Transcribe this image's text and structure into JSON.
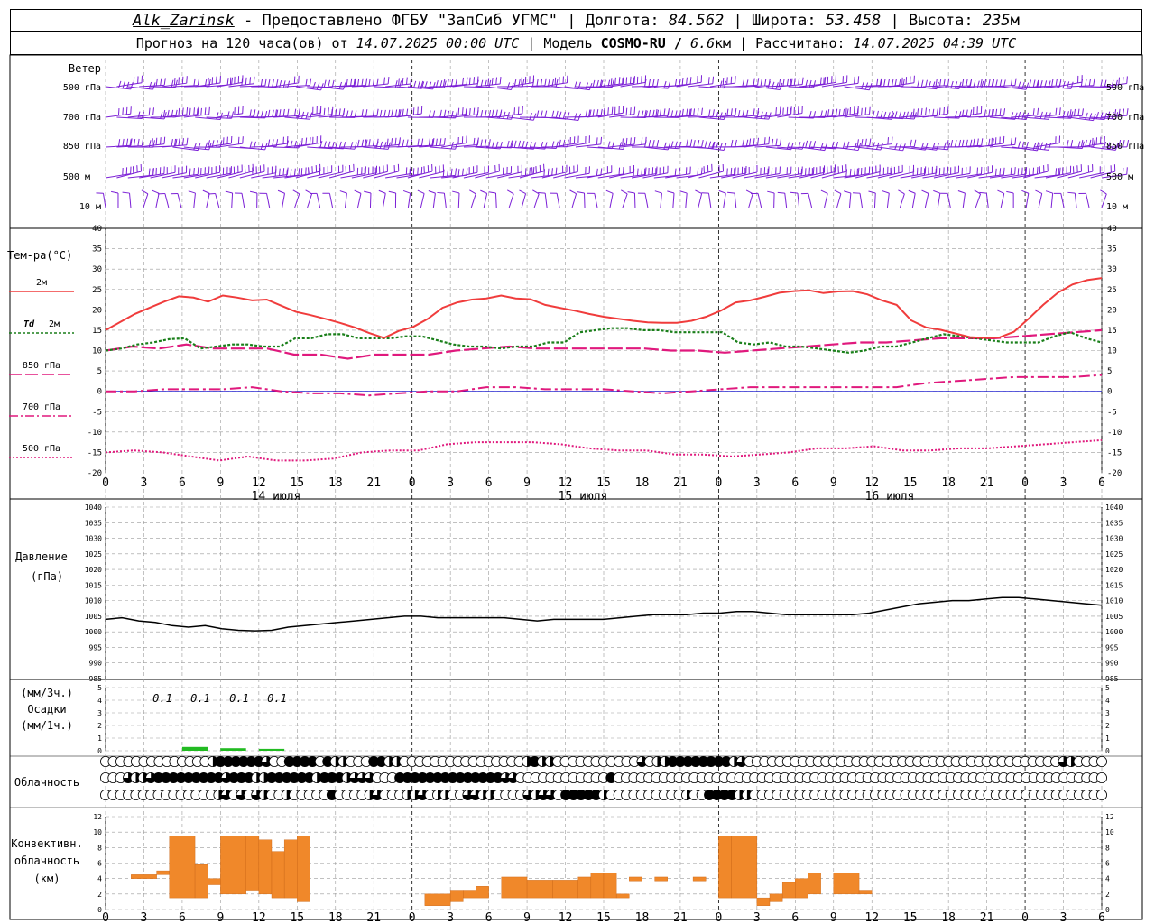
{
  "header": {
    "station": "Alk_Zarinsk",
    "provider": " - Предоставлено ФГБУ \"ЗапСиб УГМС\" | Долгота: ",
    "lon": "84.562",
    "lat_label": " | Широта: ",
    "lat": "53.458",
    "alt_label": " | Высота: ",
    "alt": "235",
    "alt_unit": "м",
    "fc_prefix": "Прогноз на 120 часа(ов) от ",
    "fc_start": "14.07.2025 00:00 UTC",
    "model_label": "  | Модель ",
    "model": "COSMO-RU / ",
    "resolution": "6.6",
    "res_unit": "км",
    "calc_label": " | Рассчитано: ",
    "calc_time": "14.07.2025 04:39 UTC"
  },
  "labels": {
    "wind": "Ветер",
    "wind_levels": [
      "500 гПа",
      "700 гПа",
      "850 гПа",
      "500 м",
      "10 м"
    ],
    "temp": "Тем-ра(°С)",
    "t2m": "2м",
    "td_a": "Td",
    "td_b": "2м",
    "t850": "850 гПа",
    "t700": "700 гПа",
    "t500": "500 гПа",
    "pressure": "Давление",
    "pressure_unit": "(гПа)",
    "precip_a": "(мм/3ч.)",
    "precip_b": "Осадки",
    "precip_c": "(мм/1ч.)",
    "cloud": "Облачность",
    "conv_a": "Конвективн.",
    "conv_b": "облачность",
    "conv_c": "(км)",
    "dates": [
      "14 июля",
      "15 июля",
      "16 июля"
    ]
  },
  "colors": {
    "wind": "#7b1fd6",
    "t2m": "#f03c3c",
    "td": "#1a7f1a",
    "t850": "#e0197d",
    "t700": "#e0197d",
    "t500": "#e0197d",
    "pressure": "#000000",
    "precip": "#22bb22",
    "conv": "#f0882a",
    "grid": "#9a9a9a"
  },
  "chart_data": [
    {
      "type": "line",
      "name": "temperature",
      "x_hours": [
        0,
        3,
        6,
        9,
        12,
        15,
        18,
        21,
        24,
        27,
        30,
        33,
        36,
        39,
        42,
        45,
        48,
        51,
        54,
        57,
        60,
        63,
        66,
        69,
        72,
        75,
        78,
        81,
        84,
        87,
        90,
        93,
        96,
        99,
        102,
        105,
        108,
        111,
        114,
        117,
        120,
        123,
        126,
        129,
        132,
        135,
        138,
        141,
        144,
        147,
        150,
        153,
        156,
        159,
        162,
        165,
        168,
        171,
        174,
        177,
        180,
        183,
        186,
        189,
        192,
        195,
        198,
        201,
        204,
        207,
        210,
        213,
        216,
        219,
        222,
        225,
        228,
        231,
        234
      ],
      "x_ticks": [
        "0",
        "3",
        "6",
        "9",
        "12",
        "15",
        "18",
        "21",
        "0",
        "3",
        "6",
        "9",
        "12",
        "15",
        "18",
        "21",
        "0",
        "3",
        "6",
        "9",
        "12",
        "15",
        "18",
        "21",
        "0",
        "3",
        "6"
      ],
      "ylim": [
        -20,
        40
      ],
      "y_ticks": [
        -20,
        -15,
        -10,
        -5,
        0,
        5,
        10,
        15,
        20,
        25,
        30,
        35,
        40
      ],
      "series_2m": [
        15,
        17,
        19,
        20.5,
        22,
        23.3,
        23,
        22,
        23.5,
        23,
        22.3,
        22.5,
        21,
        19.5,
        18.7,
        17.8,
        16.8,
        15.7,
        14.3,
        13.1,
        14.8,
        15.8,
        17.8,
        20.5,
        21.8,
        22.5,
        22.8,
        23.5,
        22.8,
        22.6,
        21.2,
        20.5,
        19.8,
        19,
        18.3,
        17.8,
        17.3,
        16.9,
        16.8,
        16.8,
        17.3,
        18.3,
        19.8,
        21.8,
        22.3,
        23.2,
        24.2,
        24.6,
        24.8,
        24.1,
        24.5,
        24.6,
        23.8,
        22.3,
        21.2,
        17.4,
        15.7,
        15.1,
        14.2,
        13.3,
        13.1,
        13.2,
        14.6,
        17.8,
        21.2,
        24.2,
        26.2,
        27.3,
        27.8
      ],
      "series_td": [
        10,
        10.5,
        11.5,
        12,
        12.8,
        13,
        10.5,
        11,
        11.5,
        11.5,
        11,
        11,
        13,
        13,
        14,
        14,
        13,
        13,
        13,
        13.5,
        13.5,
        12.5,
        11.5,
        11,
        11,
        10.5,
        11,
        11,
        12,
        12,
        14.5,
        15,
        15.5,
        15.5,
        15,
        15,
        14.5,
        14.5,
        14.5,
        14.5,
        12,
        11.5,
        12,
        11,
        11,
        10.5,
        10,
        9.5,
        10,
        11,
        11,
        12,
        13,
        14,
        13.5,
        13,
        12.5,
        12,
        12,
        12,
        13.5,
        14.5,
        13,
        12
      ],
      "series_850": [
        10,
        11,
        10.5,
        11.5,
        10.5,
        10.5,
        10.5,
        9,
        9,
        8,
        9,
        9,
        9,
        10,
        10.5,
        11,
        10.5,
        10.5,
        10.5,
        10.5,
        10.5,
        10,
        10,
        9.5,
        10,
        10.5,
        11,
        11.5,
        12,
        12,
        12.5,
        13,
        13,
        13,
        13.5,
        14,
        14.5,
        15
      ],
      "series_700": [
        0,
        0,
        0.5,
        0.5,
        0.5,
        1,
        0,
        -0.5,
        -0.5,
        -1,
        -0.5,
        0,
        0,
        1,
        1,
        0.5,
        0.5,
        0.5,
        0,
        -0.5,
        0,
        0.5,
        1,
        1,
        1,
        1,
        1,
        1,
        2,
        2.5,
        3,
        3.5,
        3.5,
        3.5,
        4
      ],
      "series_500": [
        -15,
        -14.5,
        -15,
        -16,
        -17,
        -16,
        -17,
        -17,
        -16.5,
        -15,
        -14.5,
        -14.5,
        -13,
        -12.5,
        -12.5,
        -12.5,
        -13,
        -14,
        -14.5,
        -14.5,
        -15.5,
        -15.5,
        -16,
        -15.5,
        -15,
        -14,
        -14,
        -13.5,
        -14.5,
        -14.5,
        -14,
        -14,
        -13.5,
        -13,
        -12.5,
        -12
      ]
    },
    {
      "type": "line",
      "name": "pressure",
      "ylim": [
        985,
        1040
      ],
      "y_ticks": [
        985,
        990,
        995,
        1000,
        1005,
        1010,
        1015,
        1020,
        1025,
        1030,
        1035,
        1040
      ],
      "values": [
        1004,
        1004.5,
        1003.5,
        1003,
        1002,
        1001.5,
        1002,
        1001,
        1000.5,
        1000.3,
        1000.5,
        1001.5,
        1002,
        1002.5,
        1003,
        1003.5,
        1004,
        1004.5,
        1005,
        1005,
        1004.5,
        1004.5,
        1004.5,
        1004.5,
        1004.5,
        1004,
        1003.5,
        1004,
        1004,
        1004,
        1004,
        1004.5,
        1005,
        1005.5,
        1005.5,
        1005.5,
        1006,
        1006,
        1006.5,
        1006.5,
        1006,
        1005.5,
        1005.5,
        1005.5,
        1005.5,
        1005.5,
        1006,
        1007,
        1008,
        1009,
        1009.5,
        1010,
        1010,
        1010.5,
        1011,
        1011,
        1010.5,
        1010,
        1009.5,
        1009,
        1008.5
      ]
    },
    {
      "type": "bar",
      "name": "precipitation",
      "ylim": [
        0,
        5
      ],
      "y_ticks": [
        0,
        1,
        2,
        3,
        4,
        5
      ],
      "precip_labels": [
        "0.1",
        "0.1",
        "0.1",
        "0.1"
      ],
      "bars_mm": [
        [
          6,
          0.3
        ],
        [
          9,
          0.2
        ],
        [
          12,
          0.15
        ]
      ]
    },
    {
      "type": "heatmap",
      "name": "cloud_cover_okta_rows",
      "rows": [
        [
          0,
          0,
          0,
          0,
          0,
          0,
          0,
          0,
          0,
          0,
          0,
          0,
          0,
          0,
          4,
          8,
          8,
          8,
          8,
          8,
          8,
          6,
          0,
          0,
          8,
          8,
          8,
          8,
          0,
          8,
          4,
          4,
          0,
          0,
          0,
          8,
          8,
          4,
          4,
          0,
          0,
          0,
          0,
          0,
          0,
          0,
          0,
          0,
          0,
          0,
          0,
          0,
          0,
          0,
          0,
          4,
          8,
          4,
          4,
          0,
          0,
          0,
          0,
          0,
          0,
          0,
          0,
          0,
          0,
          0,
          6,
          0,
          4,
          4,
          8,
          8,
          8,
          8,
          8,
          8,
          8,
          8,
          4,
          6,
          0,
          0,
          0,
          0,
          0,
          0,
          0,
          0,
          0,
          0,
          0,
          0,
          0,
          0,
          0,
          0,
          0,
          0,
          0,
          0,
          0,
          0,
          0,
          0,
          0,
          0,
          0,
          0,
          0,
          0,
          0,
          0,
          0,
          0,
          0,
          0,
          0,
          0,
          0,
          0,
          0,
          6,
          4,
          0,
          0,
          0,
          0
        ],
        [
          0,
          0,
          0,
          6,
          4,
          4,
          6,
          8,
          8,
          8,
          8,
          8,
          8,
          8,
          8,
          8,
          6,
          8,
          8,
          8,
          4,
          4,
          8,
          8,
          8,
          8,
          8,
          8,
          4,
          8,
          8,
          8,
          4,
          6,
          6,
          6,
          0,
          0,
          0,
          8,
          8,
          8,
          8,
          8,
          8,
          8,
          8,
          8,
          8,
          8,
          8,
          8,
          8,
          6,
          6,
          0,
          0,
          0,
          0,
          0,
          0,
          0,
          0,
          0,
          0,
          0,
          0,
          8,
          0,
          0,
          0,
          0,
          0,
          0,
          0,
          0,
          0,
          0,
          0,
          0,
          0,
          0,
          0,
          0,
          0,
          0,
          0,
          0,
          0,
          0,
          0,
          0,
          0,
          0,
          0,
          0,
          0,
          0,
          0,
          0,
          0,
          0,
          0,
          0,
          0,
          0,
          0,
          0,
          0,
          0,
          0,
          0,
          0,
          0,
          0,
          0,
          0,
          0,
          0,
          0,
          0,
          0,
          0,
          0,
          0,
          0,
          0,
          0,
          0,
          0,
          0,
          0,
          0
        ],
        [
          0,
          0,
          0,
          0,
          0,
          0,
          0,
          0,
          0,
          0,
          0,
          0,
          0,
          0,
          0,
          4,
          6,
          0,
          6,
          0,
          6,
          4,
          0,
          0,
          4,
          0,
          0,
          0,
          0,
          0,
          8,
          0,
          0,
          0,
          0,
          4,
          6,
          0,
          0,
          0,
          4,
          4,
          6,
          0,
          4,
          4,
          0,
          0,
          6,
          6,
          4,
          4,
          0,
          0,
          0,
          0,
          6,
          4,
          6,
          6,
          0,
          8,
          8,
          8,
          8,
          8,
          4,
          0,
          0,
          0,
          0,
          0,
          0,
          0,
          0,
          0,
          0,
          4,
          0,
          0,
          8,
          8,
          8,
          8,
          4,
          4,
          0,
          0,
          0,
          0,
          0,
          0,
          0,
          0,
          0,
          0,
          0,
          0,
          0,
          0,
          0,
          0,
          0,
          0,
          0,
          0,
          0,
          0,
          0,
          0,
          0,
          0,
          0,
          0,
          0,
          0,
          0,
          0,
          0,
          0,
          0,
          0,
          0,
          0,
          0,
          0,
          0,
          0,
          0,
          0,
          0,
          0,
          0
        ]
      ]
    },
    {
      "type": "bar",
      "name": "convective_cloud",
      "ylim": [
        0,
        12
      ],
      "y_ticks": [
        0,
        2,
        4,
        6,
        8,
        10,
        12
      ],
      "segments_hours_km": [
        [
          2,
          4,
          4,
          4.5
        ],
        [
          4,
          5,
          4.5,
          5
        ],
        [
          5,
          7,
          1.5,
          9.5
        ],
        [
          7,
          8,
          1.5,
          5.8
        ],
        [
          8,
          9,
          3.2,
          4
        ],
        [
          9,
          11,
          2,
          9.5
        ],
        [
          11,
          12,
          2.5,
          9.5
        ],
        [
          12,
          13,
          2,
          9
        ],
        [
          13,
          14,
          1.5,
          7.5
        ],
        [
          14,
          15,
          1.5,
          9
        ],
        [
          15,
          16,
          1,
          9.5
        ],
        [
          25,
          27,
          0.5,
          2
        ],
        [
          27,
          28,
          1,
          2.5
        ],
        [
          28,
          29,
          1.5,
          2.5
        ],
        [
          29,
          30,
          1.5,
          3
        ],
        [
          31,
          33,
          1.5,
          4.2
        ],
        [
          33,
          35,
          1.5,
          3.8
        ],
        [
          35,
          37,
          1.5,
          3.8
        ],
        [
          37,
          38,
          1.5,
          4.2
        ],
        [
          38,
          39,
          1.5,
          4.7
        ],
        [
          39,
          40,
          1.5,
          4.7
        ],
        [
          40,
          41,
          1.5,
          2
        ],
        [
          41,
          42,
          3.7,
          4.2
        ],
        [
          43,
          44,
          3.7,
          4.2
        ],
        [
          46,
          47,
          3.7,
          4.2
        ],
        [
          48,
          49,
          1.5,
          9.5
        ],
        [
          49,
          51,
          1.5,
          9.5
        ],
        [
          51,
          52,
          0.5,
          1.5
        ],
        [
          52,
          53,
          1,
          2
        ],
        [
          53,
          54,
          1.5,
          3.5
        ],
        [
          54,
          55,
          1.5,
          4
        ],
        [
          55,
          56,
          2,
          4.7
        ],
        [
          57,
          59,
          2,
          4.7
        ],
        [
          59,
          60,
          2,
          2.5
        ]
      ]
    }
  ]
}
